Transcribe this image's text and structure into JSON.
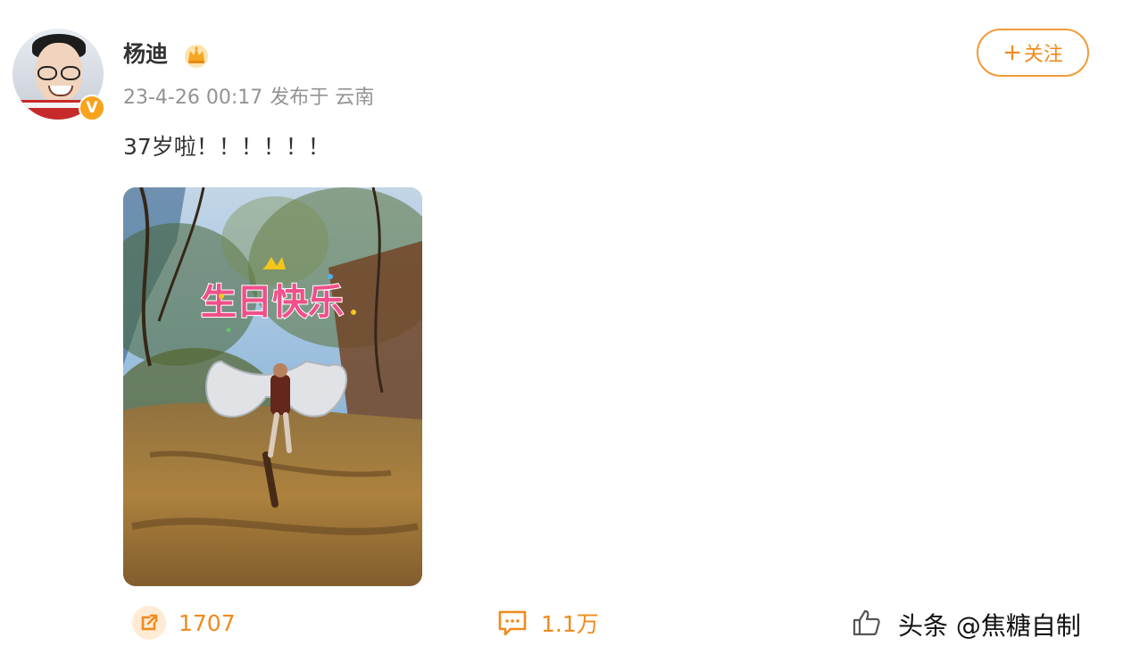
{
  "user": {
    "name": "杨迪",
    "verify_mark": "V"
  },
  "meta": {
    "time": "23-4-26 00:17",
    "source": "发布于 云南"
  },
  "follow": {
    "plus": "+",
    "label": "关注"
  },
  "post": {
    "text": "37岁啦！！！！！！",
    "image_caption": "生日快乐"
  },
  "actions": {
    "repost_count": "1707",
    "comment_count": "1.1万",
    "like_count": ""
  },
  "watermark": "头条 @焦糖自制",
  "colors": {
    "accent": "#f08a1d",
    "meta_gray": "#939393",
    "badge": "#f7a41c"
  },
  "icons": {
    "repost": "repost-icon",
    "comment": "comment-icon",
    "like": "thumbs-up-icon",
    "crown": "crown-icon",
    "verify": "verified-badge-icon"
  }
}
